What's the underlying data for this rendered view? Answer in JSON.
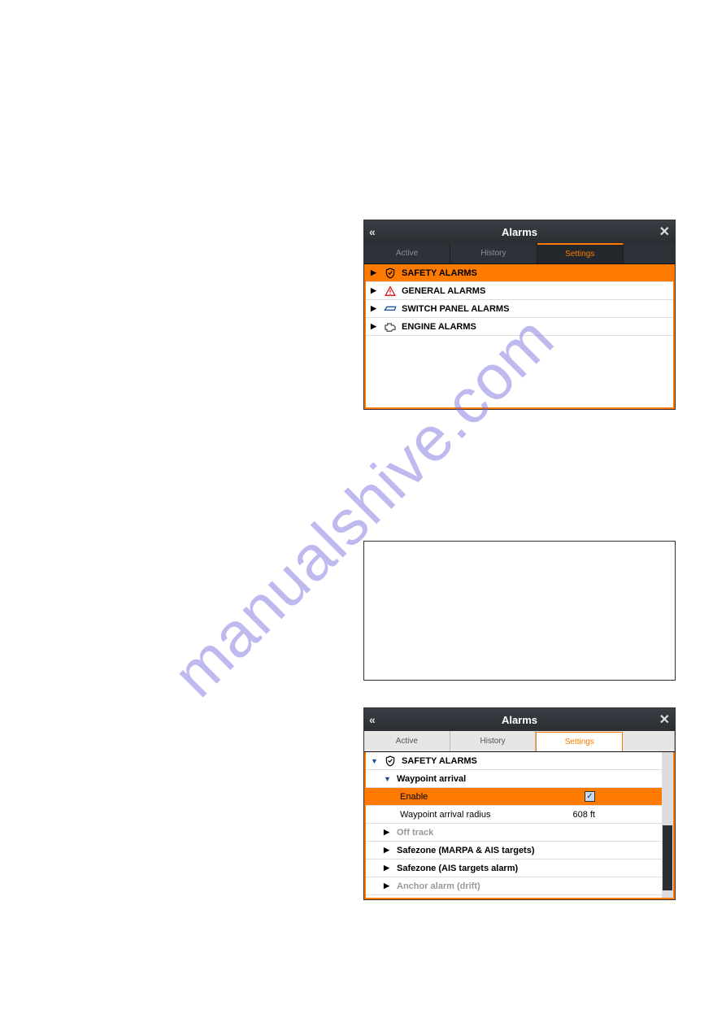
{
  "watermark": "manualshive.com",
  "panel1": {
    "title": "Alarms",
    "tabs": {
      "active": "Active",
      "history": "History",
      "settings": "Settings"
    },
    "rows": {
      "safety": "SAFETY ALARMS",
      "general": "GENERAL ALARMS",
      "switch": "SWITCH PANEL ALARMS",
      "engine": "ENGINE ALARMS"
    }
  },
  "panel3": {
    "title": "Alarms",
    "tabs": {
      "active": "Active",
      "history": "History",
      "settings": "Settings"
    },
    "rows": {
      "safety": "SAFETY ALARMS",
      "waypoint": "Waypoint arrival",
      "enable": "Enable",
      "radius_label": "Waypoint arrival radius",
      "radius_value": "608 ft",
      "offtrack": "Off track",
      "safezone1": "Safezone (MARPA & AIS targets)",
      "safezone2": "Safezone (AIS targets alarm)",
      "anchor": "Anchor alarm (drift)"
    }
  }
}
